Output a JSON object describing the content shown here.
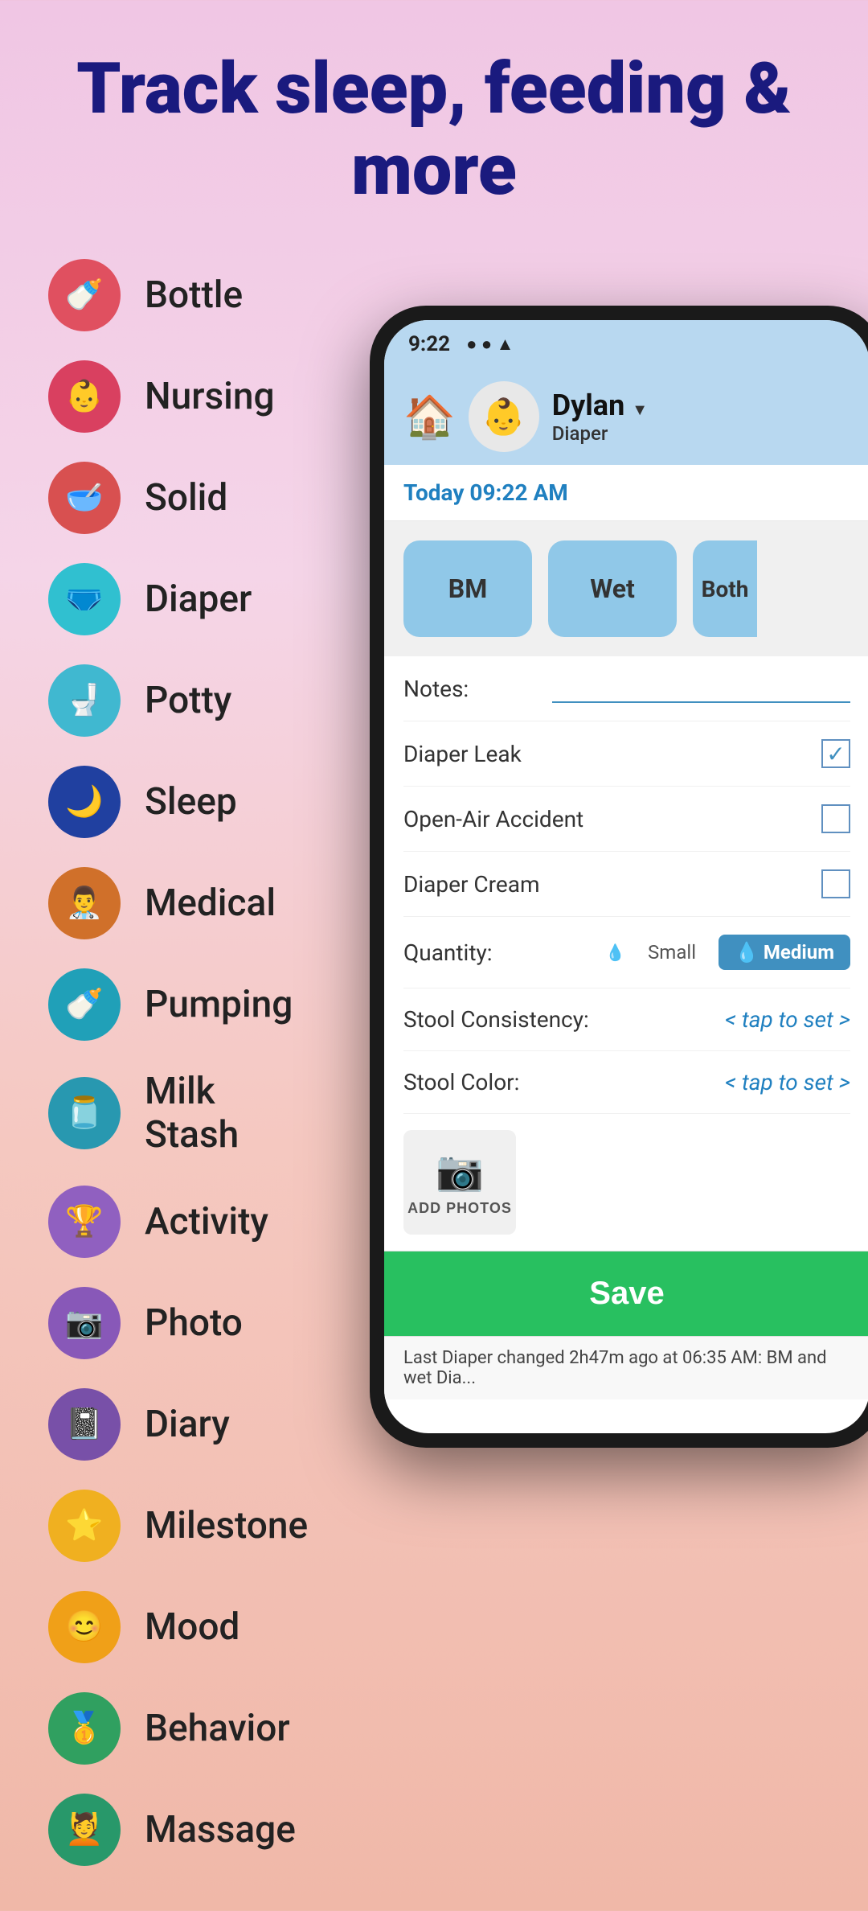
{
  "header": {
    "title": "Track sleep, feeding & more"
  },
  "features": [
    {
      "id": "bottle",
      "label": "Bottle",
      "icon": "🍼",
      "iconClass": "icon-red"
    },
    {
      "id": "nursing",
      "label": "Nursing",
      "icon": "👶",
      "iconClass": "icon-pink"
    },
    {
      "id": "solid",
      "label": "Solid",
      "icon": "🥣",
      "iconClass": "icon-salmon"
    },
    {
      "id": "diaper",
      "label": "Diaper",
      "icon": "🩲",
      "iconClass": "icon-cyan"
    },
    {
      "id": "potty",
      "label": "Potty",
      "icon": "🚽",
      "iconClass": "icon-lightblue"
    },
    {
      "id": "sleep",
      "label": "Sleep",
      "icon": "🌙",
      "iconClass": "icon-darkblue"
    },
    {
      "id": "medical",
      "label": "Medical",
      "icon": "👨‍⚕️",
      "iconClass": "icon-orange"
    },
    {
      "id": "pumping",
      "label": "Pumping",
      "icon": "🍼",
      "iconClass": "icon-teal"
    },
    {
      "id": "milk-stash",
      "label": "Milk Stash",
      "icon": "🫙",
      "iconClass": "icon-steelteal"
    },
    {
      "id": "activity",
      "label": "Activity",
      "icon": "🏆",
      "iconClass": "icon-purple"
    },
    {
      "id": "photo",
      "label": "Photo",
      "icon": "📷",
      "iconClass": "icon-purple2"
    },
    {
      "id": "diary",
      "label": "Diary",
      "icon": "📓",
      "iconClass": "icon-purple3"
    },
    {
      "id": "milestone",
      "label": "Milestone",
      "icon": "⭐",
      "iconClass": "icon-yellow"
    },
    {
      "id": "mood",
      "label": "Mood",
      "icon": "😊",
      "iconClass": "icon-gold"
    },
    {
      "id": "behavior",
      "label": "Behavior",
      "icon": "🥇",
      "iconClass": "icon-green"
    },
    {
      "id": "massage",
      "label": "Massage",
      "icon": "💆",
      "iconClass": "icon-green2"
    }
  ],
  "phone": {
    "status_bar": {
      "time": "9:22",
      "icons": [
        "●",
        "●",
        "▲"
      ]
    },
    "header": {
      "user_name": "Dylan",
      "section": "Diaper",
      "avatar": "👶"
    },
    "date_time": "Today 09:22 AM",
    "diaper_buttons": [
      "BM",
      "Wet",
      "Both"
    ],
    "form": {
      "notes_label": "Notes:",
      "diaper_leak_label": "Diaper Leak",
      "diaper_leak_checked": true,
      "open_air_label": "Open-Air Accident",
      "open_air_checked": false,
      "diaper_cream_label": "Diaper Cream",
      "diaper_cream_checked": false,
      "quantity_label": "Quantity:",
      "quantity_small": "Small",
      "quantity_medium": "Medium",
      "stool_consistency_label": "Stool Consistency:",
      "stool_consistency_value": "< tap to set >",
      "stool_color_label": "Stool Color:",
      "stool_color_value": "< tap to set >"
    },
    "add_photos_label": "ADD PHOTOS",
    "save_label": "Save",
    "last_diaper_text": "Last Diaper changed 2h47m ago at 06:35 AM:  BM and wet Dia..."
  }
}
